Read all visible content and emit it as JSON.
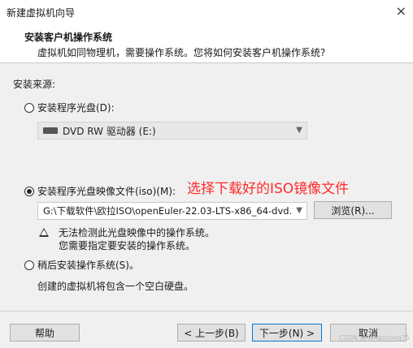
{
  "window": {
    "title": "新建虚拟机向导",
    "close": "×"
  },
  "header": {
    "title": "安装客户机操作系统",
    "subtitle": "虚拟机如同物理机，需要操作系统。您将如何安装客户机操作系统?"
  },
  "source": {
    "label": "安装来源:",
    "disc": {
      "label": "安装程序光盘(D):",
      "selected": false,
      "drive": "DVD RW 驱动器 (E:)"
    },
    "iso": {
      "label": "安装程序光盘映像文件(iso)(M):",
      "selected": true,
      "path": "G:\\下载软件\\欧拉ISO\\openEuler-22.03-LTS-x86_64-dvd.",
      "browse": "浏览(R)..."
    },
    "warning": {
      "line1": "无法检测此光盘映像中的操作系统。",
      "line2": "您需要指定要安装的操作系统。"
    },
    "later": {
      "label": "稍后安装操作系统(S)。",
      "selected": false
    },
    "disk_note": "创建的虚拟机将包含一个空白硬盘。"
  },
  "annotation": "选择下载好的ISO镜像文件",
  "buttons": {
    "help": "帮助",
    "back": "< 上一步(B)",
    "next": "下一步(N) >",
    "cancel": "取消"
  },
  "watermark": "CSDN @Yangchong75"
}
